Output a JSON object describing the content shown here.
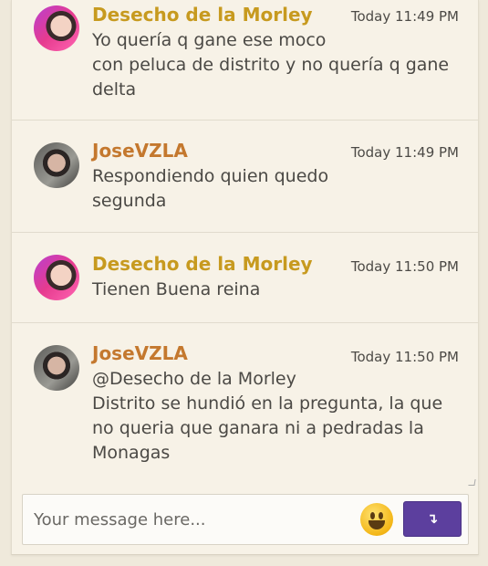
{
  "messages": [
    {
      "author": "Desecho de la Morley",
      "time": "Today 11:49 PM",
      "text": "Yo quería q gane ese moco\ncon peluca de distrito y no quería q gane\ndelta"
    },
    {
      "author": "JoseVZLA",
      "time": "Today 11:49 PM",
      "text": "Respondiendo quien quedo\nsegunda"
    },
    {
      "author": "Desecho de la Morley",
      "time": "Today 11:50 PM",
      "text": "Tienen Buena reina"
    },
    {
      "author": "JoseVZLA",
      "time": "Today 11:50 PM",
      "text": "@Desecho de la Morley\nDistrito se hundió en la pregunta, la que\nno queria que ganara ni a pedradas la\nMonagas"
    }
  ],
  "composer": {
    "placeholder": "Your message here...",
    "emoji_icon": "smiley-emoji-icon",
    "send_icon": "send-arrow-icon",
    "send_glyph": "↴"
  },
  "colors": {
    "author_gold": "#c79a1f",
    "author_orange": "#c4782e",
    "send_button": "#5c3f9e"
  }
}
